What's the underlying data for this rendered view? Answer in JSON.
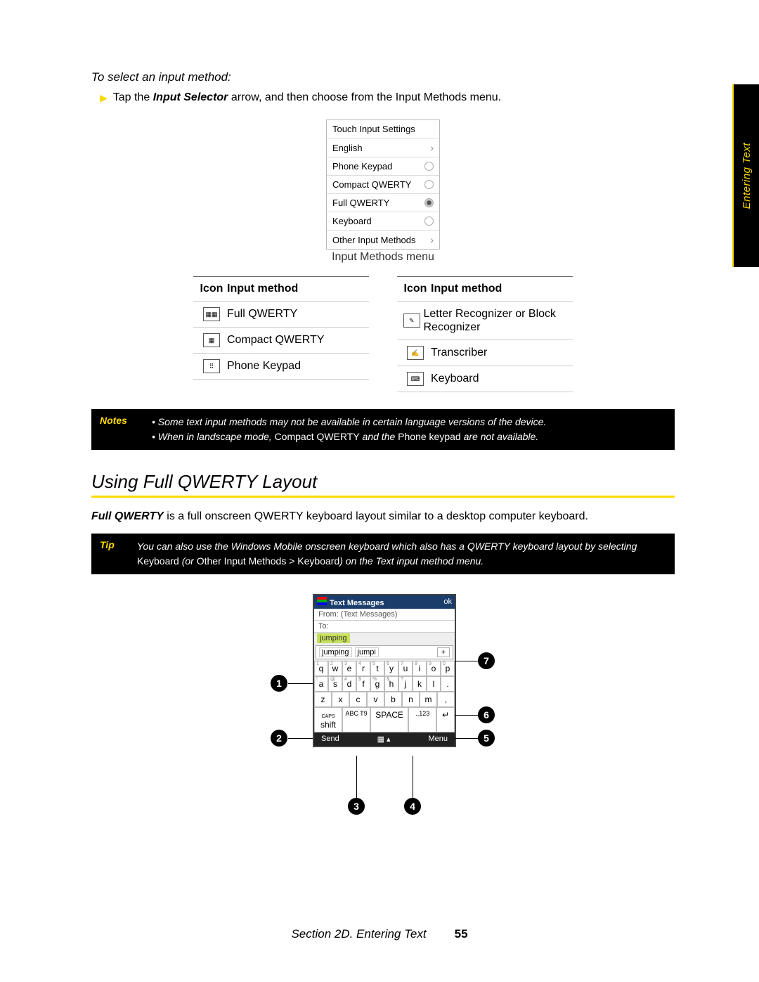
{
  "sideTab": "Entering Text",
  "leadIn": "To select an input method:",
  "bullet": {
    "pre": "Tap the ",
    "bold": "Input Selector",
    "post": " arrow, and then choose from the Input Methods menu."
  },
  "menu": {
    "rows": [
      "Touch Input Settings",
      "English",
      "Phone Keypad",
      "Compact QWERTY",
      "Full QWERTY",
      "Keyboard",
      "Other Input Methods"
    ],
    "caption": "Input Methods menu"
  },
  "tableHead": {
    "icon": "Icon",
    "method": "Input method"
  },
  "leftTable": [
    {
      "label": "Full QWERTY"
    },
    {
      "label": "Compact QWERTY"
    },
    {
      "label": "Phone Keypad"
    }
  ],
  "rightTable": [
    {
      "label": "Letter Recognizer or Block Recognizer"
    },
    {
      "label": "Transcriber"
    },
    {
      "label": "Keyboard"
    }
  ],
  "notes": {
    "label": "Notes",
    "line1": "Some text input methods may not be available in certain language versions of the device.",
    "line2a": "When in landscape mode, ",
    "line2b": "Compact QWERTY",
    "line2c": " and the ",
    "line2d": "Phone keypad",
    "line2e": " are not available."
  },
  "sectionTitle": "Using Full QWERTY Layout",
  "para": {
    "bold": "Full QWERTY",
    "rest": " is a full onscreen QWERTY keyboard layout similar to a desktop computer keyboard."
  },
  "tip": {
    "label": "Tip",
    "a": "You can also use the Windows Mobile onscreen keyboard which also has a QWERTY keyboard layout by selecting ",
    "b": "Keyboard",
    "c": " (or ",
    "d": "Other Input Methods > Keyboard",
    "e": ") on the Text input method menu."
  },
  "phone": {
    "title": "Text Messages",
    "ok": "ok",
    "from": "From: (Text Messages)",
    "to": "To:",
    "hl": "jumping",
    "s1": "jumping",
    "s2": "jumpi",
    "plus": "+",
    "row1": [
      "q",
      "w",
      "e",
      "r",
      "t",
      "y",
      "u",
      "i",
      "o",
      "p"
    ],
    "sup1": [
      "1",
      "2",
      "3",
      "4",
      "5",
      "6",
      "7",
      "8",
      "9",
      "0"
    ],
    "row2": [
      "a",
      "s",
      "d",
      "f",
      "g",
      "h",
      "j",
      "k",
      "l",
      "."
    ],
    "sup2": [
      "!",
      "@",
      "#",
      "$",
      "%",
      "&",
      "?",
      "",
      "",
      ""
    ],
    "row3": [
      "z",
      "x",
      "c",
      "v",
      "b",
      "n",
      "m",
      ","
    ],
    "caps": "CAPS",
    "shift": "shift",
    "abc": "ABC T9",
    "space": "SPACE",
    "sym": ".,123",
    "enter": "↵",
    "send": "Send",
    "menu": "Menu"
  },
  "callouts": [
    "1",
    "2",
    "3",
    "4",
    "5",
    "6",
    "7"
  ],
  "footer": {
    "section": "Section 2D. Entering Text",
    "page": "55"
  }
}
